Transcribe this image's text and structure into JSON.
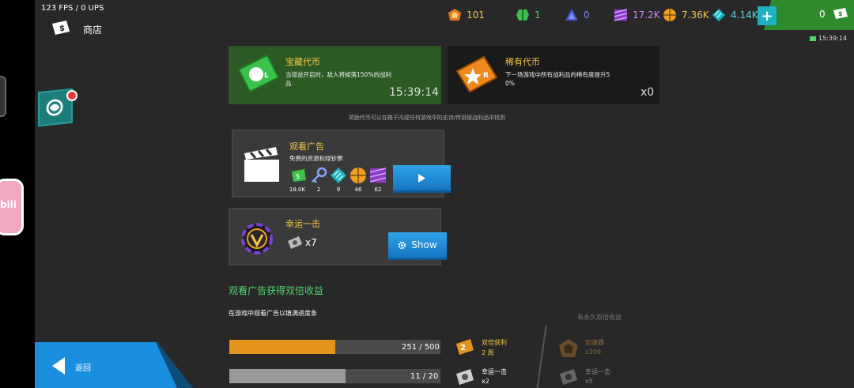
{
  "status": {
    "fps": "123 FPS / 0 UPS"
  },
  "header": {
    "title": "商店"
  },
  "resources": {
    "orange": "101",
    "green": "1",
    "blue": "0",
    "purple": "17.2K",
    "gold": "7.36K",
    "cyan": "4.14K",
    "tickets": "0",
    "timer": "15:39:14"
  },
  "cards": {
    "treasure": {
      "title": "宝藏代币",
      "desc1": "当增益开启时，敌人将掉落150%的战利",
      "desc2": "品",
      "timer": "15:39:14"
    },
    "rare": {
      "title": "稀有代币",
      "desc1": "下一场游戏中所有战利品的稀有度提升5",
      "desc2": "0%",
      "count": "x0"
    }
  },
  "hint": "奖励代币可以在箱子内或任何游戏中的史诗/传说级战利品中找到",
  "ad_panel": {
    "title": "观看广告",
    "desc": "免费的资源和绿钞票",
    "rewards": [
      {
        "icon": "cash-icon",
        "value": "18.0K"
      },
      {
        "icon": "key-icon",
        "value": "2"
      },
      {
        "icon": "cyan-gem-icon",
        "value": "9"
      },
      {
        "icon": "gold-ball-icon",
        "value": "46"
      },
      {
        "icon": "purple-crystal-icon",
        "value": "62"
      }
    ]
  },
  "lucky": {
    "title": "幸运一击",
    "count": "x7",
    "button": "Show"
  },
  "double": {
    "title": "观看广告获得双倍收益",
    "desc": "在游戏中观看广告以填满进度条",
    "permanent": "有永久双倍收益",
    "bars": [
      {
        "text": "251 / 500",
        "progress": 0.502,
        "color": "#e3941c",
        "reward_title": "双倍获利",
        "reward_sub": "2 周"
      },
      {
        "text": "11 / 20",
        "progress": 0.55,
        "color": "#9a9a9a",
        "reward_title": "幸运一击",
        "reward_sub": "x2"
      }
    ],
    "perm_items": [
      {
        "title": "加速器",
        "sub": "x200"
      },
      {
        "title": "幸运一击",
        "sub": "x5"
      }
    ]
  },
  "back": {
    "label": "返回"
  },
  "side": {
    "bili": "bili"
  },
  "colors": {
    "accent_green": "#2d8a2d",
    "button_blue": "#1a8fe0",
    "gold": "#f5c542",
    "title_green": "#4fd66a"
  }
}
